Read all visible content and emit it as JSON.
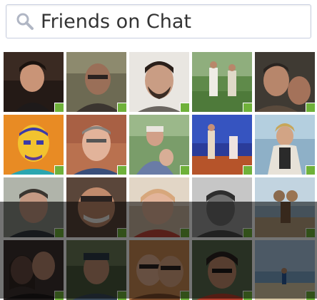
{
  "search": {
    "placeholder": "Friends on Chat",
    "icon": "search-icon"
  },
  "colors": {
    "online": "#6fb13a",
    "search_border": "#c8cfe0",
    "placeholder_text": "#333333"
  },
  "friends": [
    {
      "status": "online"
    },
    {
      "status": "online"
    },
    {
      "status": "online"
    },
    {
      "status": "online"
    },
    {
      "status": "online"
    },
    {
      "status": "online"
    },
    {
      "status": "online"
    },
    {
      "status": "online"
    },
    {
      "status": "online"
    },
    {
      "status": "online"
    },
    {
      "status": "online"
    },
    {
      "status": "online"
    },
    {
      "status": "online"
    },
    {
      "status": "online"
    },
    {
      "status": "online"
    },
    {
      "status": "online"
    },
    {
      "status": "online"
    },
    {
      "status": "online"
    },
    {
      "status": "online"
    },
    {
      "status": "online"
    }
  ]
}
